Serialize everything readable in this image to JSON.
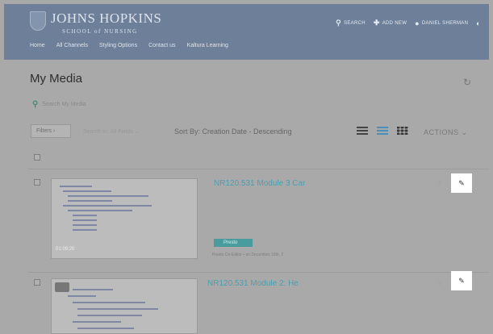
{
  "header": {
    "logo_main": "JOHNS HOPKINS",
    "logo_sub": "SCHOOL of NURSING",
    "actions": [
      {
        "icon": "search-icon",
        "glyph": "⚲",
        "label": "SEARCH"
      },
      {
        "icon": "plus-icon",
        "glyph": "✚",
        "label": "ADD NEW"
      },
      {
        "icon": "user-icon",
        "glyph": "●",
        "label": "DANIEL SHERMAN"
      },
      {
        "icon": "half-circle-icon",
        "glyph": "◐",
        "label": ""
      }
    ],
    "nav": [
      "Home",
      "All Channels",
      "Styling Options",
      "Contact us",
      "Kaltura Learning"
    ]
  },
  "page": {
    "title": "My Media",
    "refresh_glyph": "↻",
    "search_glyph": "⚲",
    "search_placeholder": "Search My Media"
  },
  "toolbar": {
    "filters_label": "Filters ›",
    "search_fields": "Search In: All Fields ⌄",
    "sort_by": "Sort By: Creation Date - Descending",
    "actions_label": "ACTIONS ⌄"
  },
  "media": [
    {
      "title": "NR120.531 Module 3 Car",
      "duration": "01:09:20",
      "type": "Presto",
      "meta": "Presto Co-Editor • on December 10th, 2",
      "likes": "♡",
      "edit_glyph": "✎"
    },
    {
      "title": "NR120.531 Module 2: He",
      "duration": "",
      "type": "",
      "meta": "",
      "likes": "♡",
      "edit_glyph": "✎"
    }
  ]
}
